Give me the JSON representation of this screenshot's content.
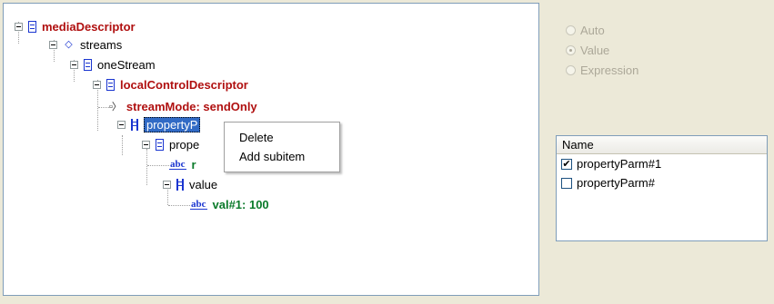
{
  "tree": {
    "nodes": [
      {
        "label": "mediaDescriptor",
        "icon": "struct-icon"
      },
      {
        "label": "streams",
        "icon": "choice-icon"
      },
      {
        "label": "oneStream",
        "icon": "struct-icon"
      },
      {
        "label": "localControlDescriptor",
        "icon": "struct-icon"
      },
      {
        "label": "streamMode: sendOnly",
        "icon": "enum-icon"
      },
      {
        "label": "propertyP",
        "icon": "list-icon"
      },
      {
        "label": "prope",
        "icon": "struct-icon"
      },
      {
        "label": "r",
        "icon": "abc-icon"
      },
      {
        "label": "value",
        "icon": "list-icon"
      },
      {
        "label": "val#1: 100",
        "icon": "abc-icon"
      }
    ]
  },
  "icons": {
    "abc": "abc",
    "enum": "▫〉"
  },
  "context_menu": {
    "items": [
      "Delete",
      "Add subitem"
    ]
  },
  "mode": {
    "options": [
      {
        "label": "Auto",
        "checked": false
      },
      {
        "label": "Value",
        "checked": true
      },
      {
        "label": "Expression",
        "checked": false
      }
    ]
  },
  "list": {
    "header": "Name",
    "rows": [
      {
        "label": "propertyParm#1",
        "checked": true,
        "mark": "✔"
      },
      {
        "label": "propertyParm#",
        "checked": false,
        "mark": ""
      }
    ]
  },
  "colors": {
    "accent_red": "#b01010",
    "accent_green": "#0a7a2a",
    "selection": "#316ac5"
  }
}
